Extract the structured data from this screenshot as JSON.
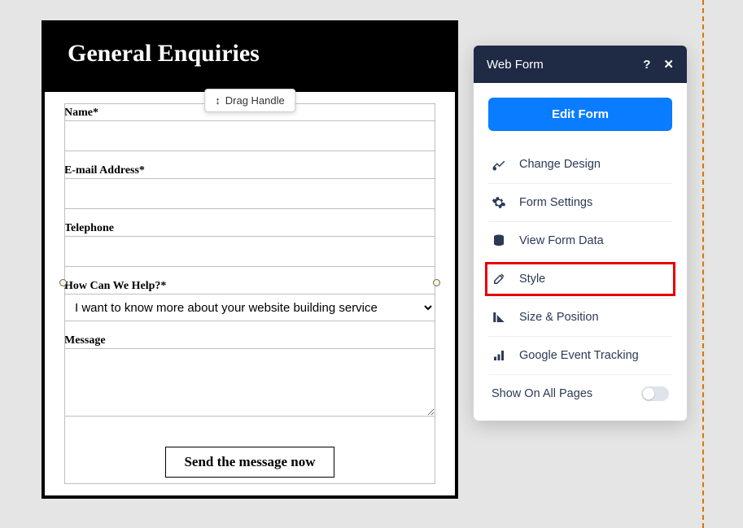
{
  "form": {
    "title": "General Enquiries",
    "drag_handle_label": "Drag Handle",
    "fields": {
      "name_label": "Name*",
      "email_label": "E-mail Address*",
      "telephone_label": "Telephone",
      "help_label": "How Can We Help?*",
      "help_selected": "I want to know more about your website building service",
      "message_label": "Message"
    },
    "submit_label": "Send the message now"
  },
  "panel": {
    "title": "Web Form",
    "edit_button": "Edit Form",
    "items": [
      {
        "label": "Change Design"
      },
      {
        "label": "Form Settings"
      },
      {
        "label": "View Form Data"
      },
      {
        "label": "Style"
      },
      {
        "label": "Size & Position"
      },
      {
        "label": "Google Event Tracking"
      }
    ],
    "show_on_label": "Show On All Pages",
    "show_on_value": false
  }
}
